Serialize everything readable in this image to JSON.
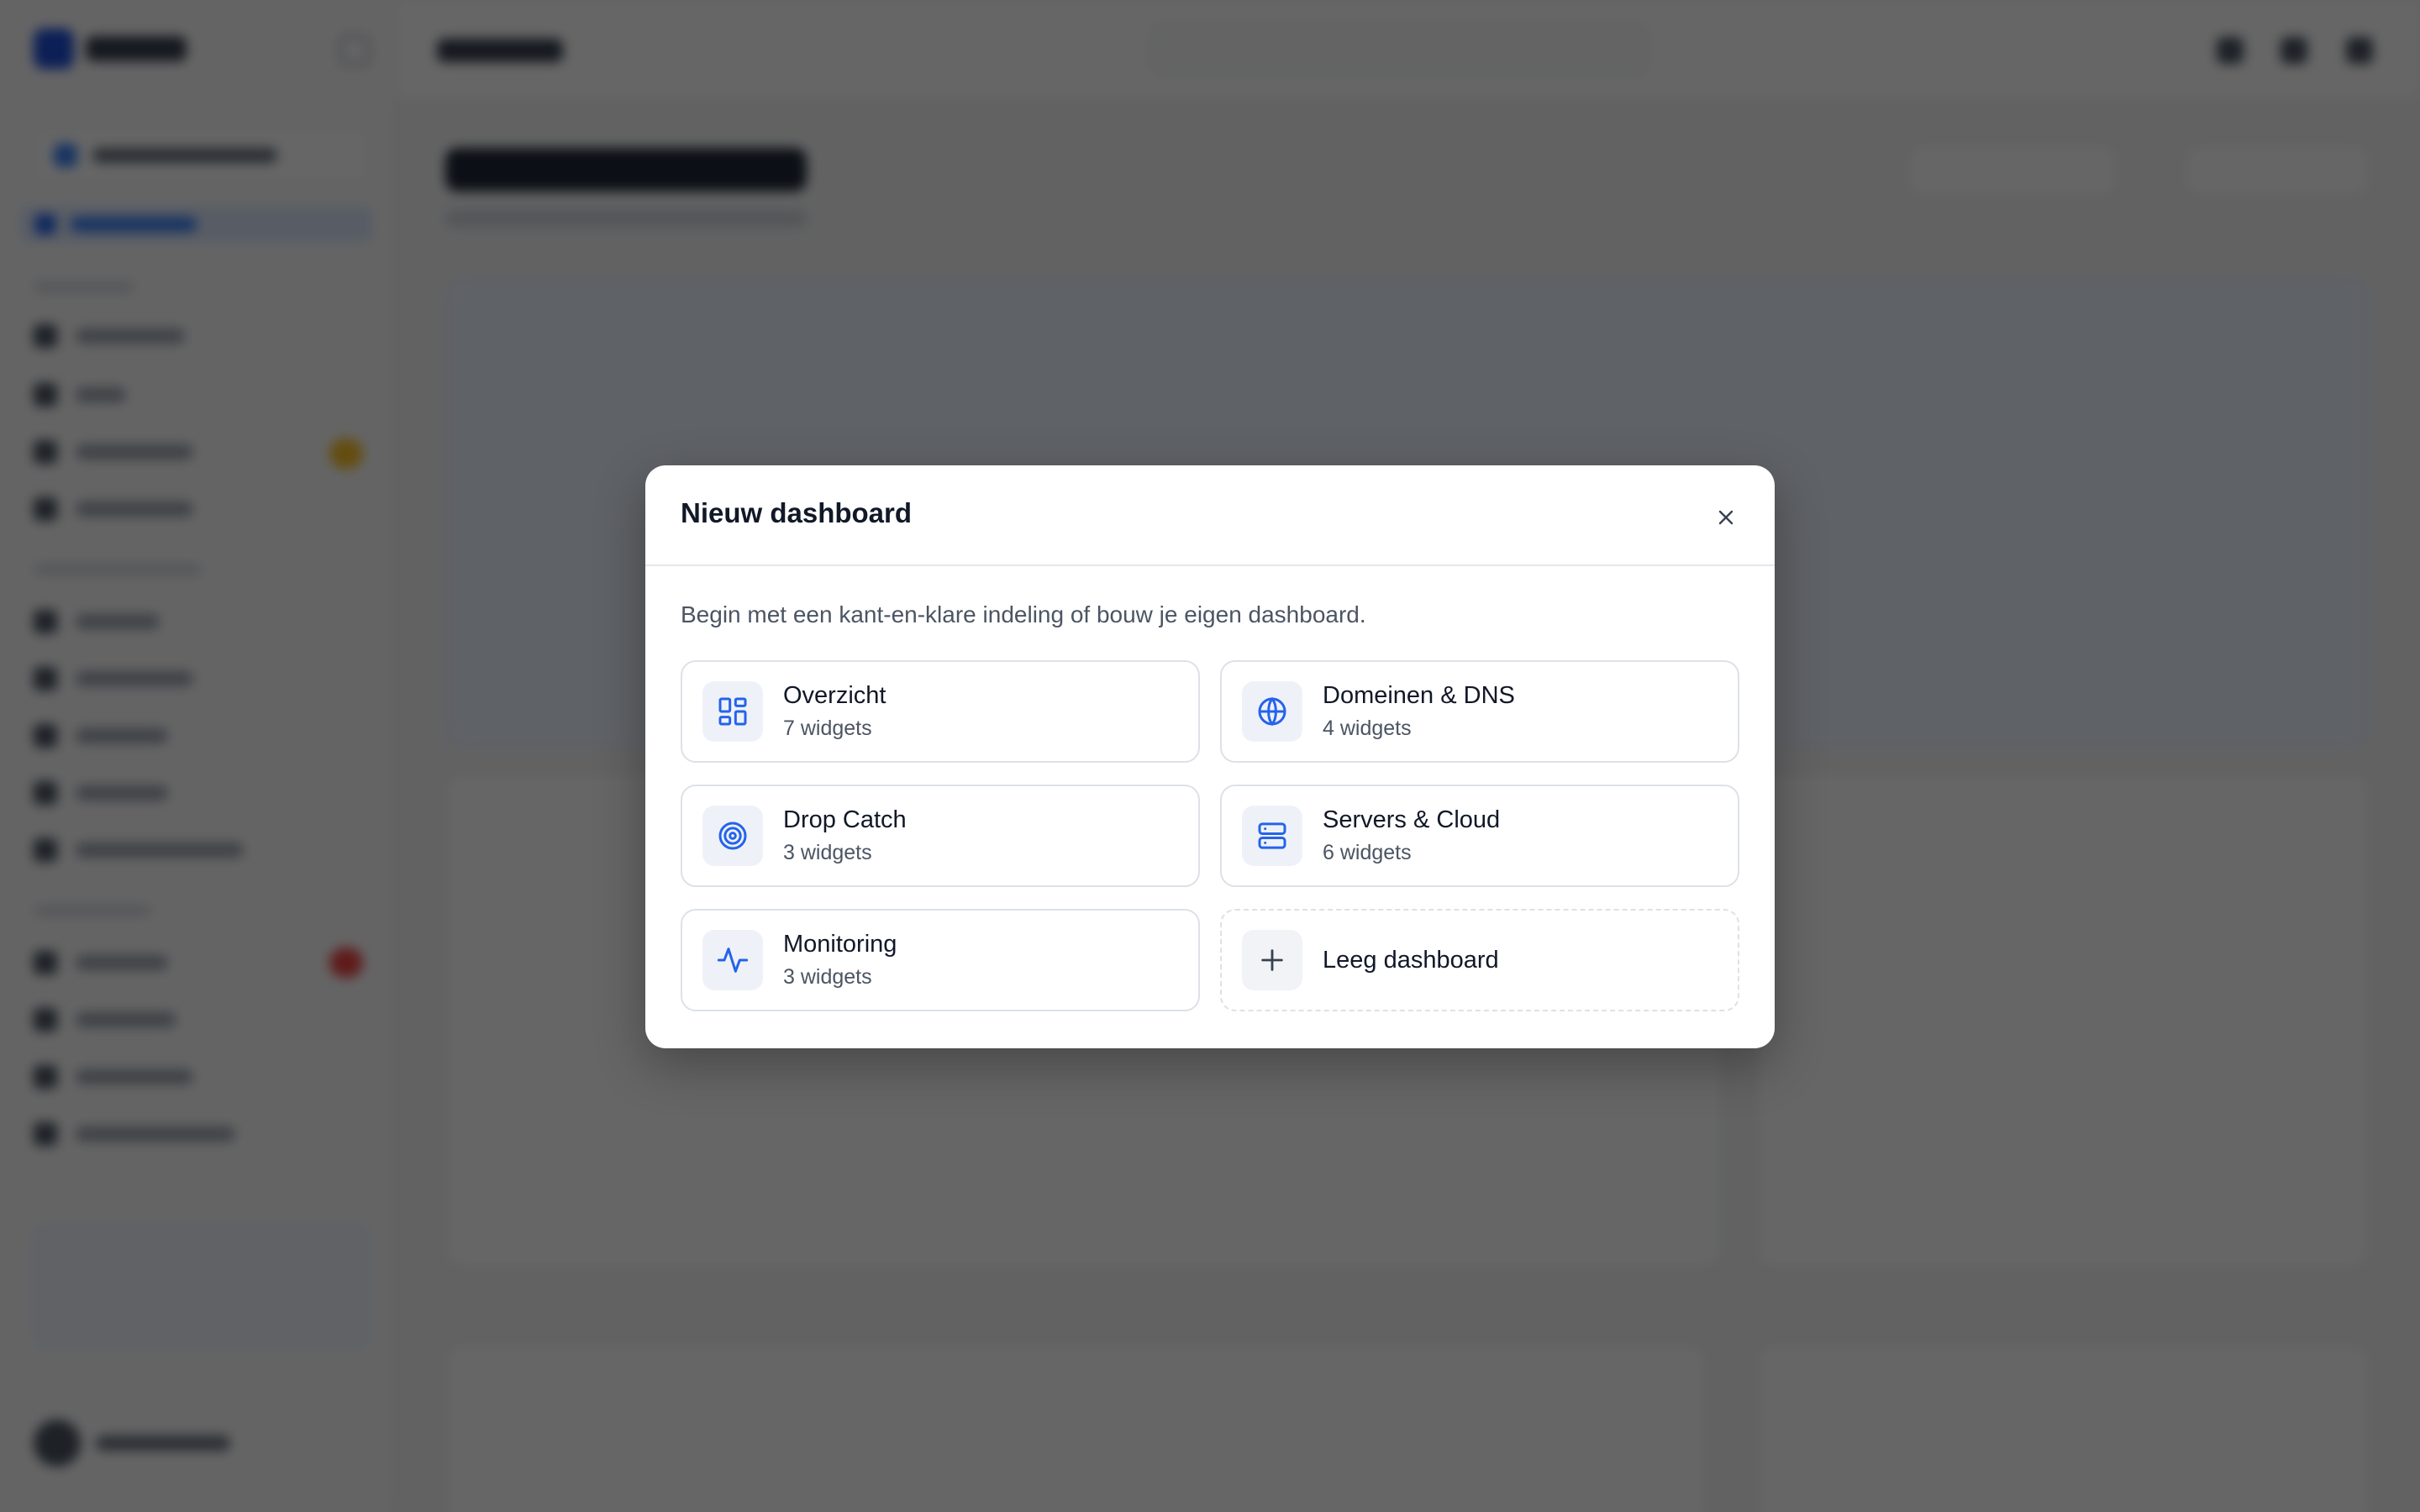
{
  "modal": {
    "title": "Nieuw dashboard",
    "description": "Begin met een kant-en-klare indeling of bouw je eigen dashboard.",
    "templates": [
      {
        "name": "Overzicht",
        "count": "7 widgets",
        "icon": "layout-grid-icon"
      },
      {
        "name": "Domeinen & DNS",
        "count": "4 widgets",
        "icon": "globe-icon"
      },
      {
        "name": "Drop Catch",
        "count": "3 widgets",
        "icon": "target-icon"
      },
      {
        "name": "Servers & Cloud",
        "count": "6 widgets",
        "icon": "server-icon"
      },
      {
        "name": "Monitoring",
        "count": "3 widgets",
        "icon": "activity-icon"
      }
    ],
    "empty_option": {
      "name": "Leeg dashboard",
      "icon": "plus-icon"
    }
  },
  "colors": {
    "accent": "#2563eb",
    "overlay": "rgba(0,0,0,0.6)"
  }
}
